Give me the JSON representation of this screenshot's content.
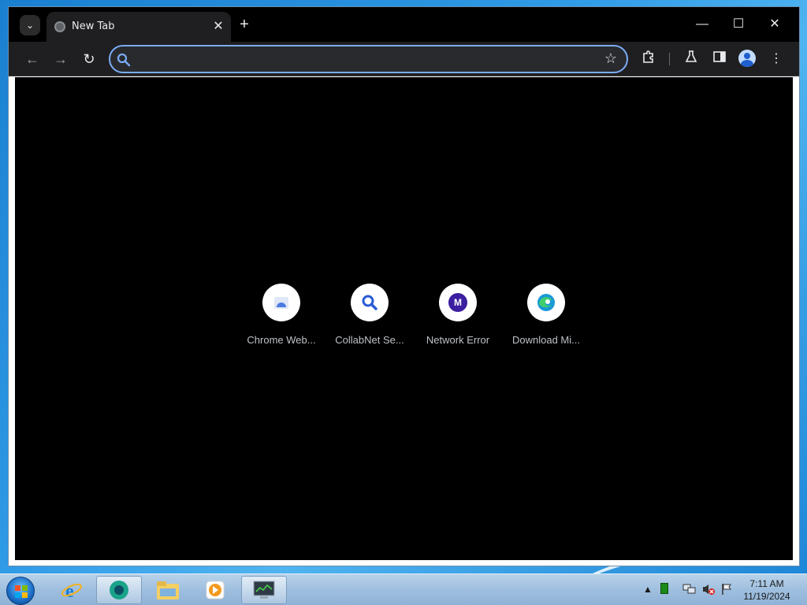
{
  "browser": {
    "tab": {
      "title": "New Tab"
    },
    "window_controls": {
      "minimize": "—",
      "maximize": "☐",
      "close": "✕"
    },
    "omnibox": {
      "value": "",
      "placeholder": ""
    }
  },
  "new_tab_page": {
    "shortcuts": [
      {
        "label": "Chrome Web...",
        "icon": "chrome-web-store-icon"
      },
      {
        "label": "CollabNet Se...",
        "icon": "search-magnifier-icon"
      },
      {
        "label": "Network Error",
        "icon": "letter-m-icon",
        "icon_letter": "M"
      },
      {
        "label": "Download Mi...",
        "icon": "edge-icon"
      }
    ]
  },
  "taskbar": {
    "clock": {
      "time": "7:11 AM",
      "date": "11/19/2024"
    }
  },
  "colors": {
    "omnibox_focus": "#7cacf8",
    "content_bg": "#000000",
    "titlebar_bg": "#000000",
    "toolbar_bg": "#1f1f21"
  }
}
